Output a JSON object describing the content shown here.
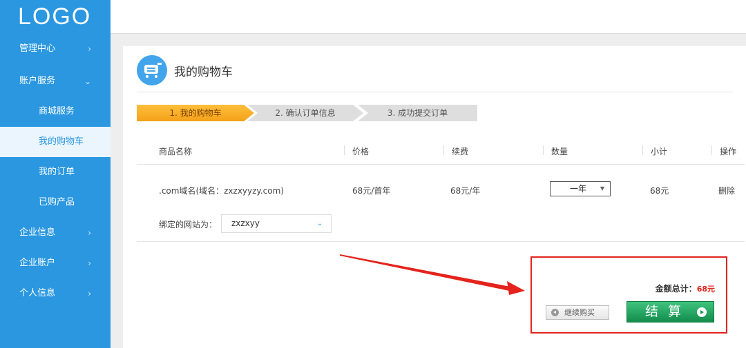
{
  "brand": {
    "logo": "LOGO"
  },
  "sidebar": {
    "items": [
      {
        "label": "管理中心",
        "arrow": "›"
      },
      {
        "label": "账户服务",
        "arrow": "⌄"
      },
      {
        "label": "商城服务"
      },
      {
        "label": "我的购物车"
      },
      {
        "label": "我的订单"
      },
      {
        "label": "已购产品"
      },
      {
        "label": "企业信息",
        "arrow": "›"
      },
      {
        "label": "企业账户",
        "arrow": "›"
      },
      {
        "label": "个人信息",
        "arrow": "›"
      }
    ]
  },
  "page": {
    "title": "我的购物车",
    "title_icon": "shopping-cart-icon"
  },
  "steps": [
    "1. 我的购物车",
    "2. 确认订单信息",
    "3. 成功提交订单"
  ],
  "table": {
    "headers": [
      "商品名称",
      "价格",
      "续费",
      "数量",
      "小计",
      "操作"
    ],
    "row": {
      "name": ".com域名(域名：zxzxyyzy.com)",
      "price": "68元/首年",
      "renew": "68元/年",
      "quantity": "一年",
      "subtotal": "68元",
      "action": "删除"
    }
  },
  "binding": {
    "label": "绑定的网站为：",
    "value": "zxzxyy"
  },
  "checkout": {
    "total_label": "金额总计：",
    "total_value": "68元",
    "continue_label": "继续购买",
    "checkout_label": "结算"
  },
  "colors": {
    "sidebar": "#2a97e0",
    "highlight": "#e3231c",
    "step_active": "#f4a11a",
    "checkout_green": "#1a9a55"
  }
}
